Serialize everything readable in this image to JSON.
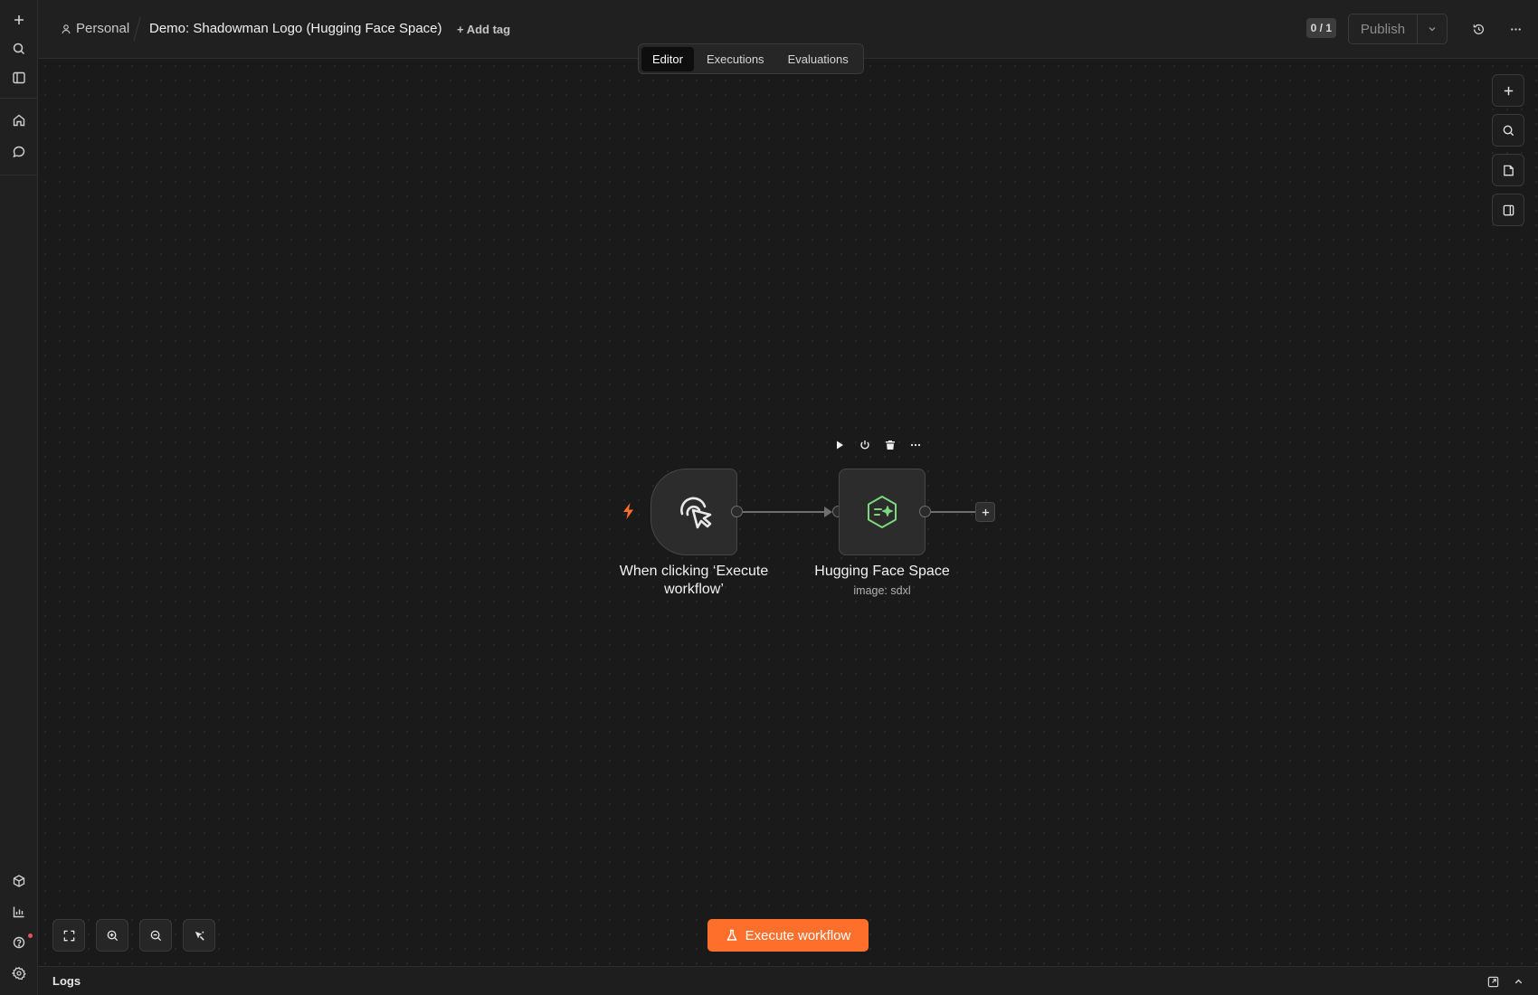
{
  "header": {
    "project_label": "Personal",
    "workflow_title": "Demo: Shadowman Logo (Hugging Face Space)",
    "add_tag_label": "+ Add tag",
    "counter": "0 / 1",
    "publish_label": "Publish"
  },
  "tabs": [
    {
      "label": "Editor",
      "active": true
    },
    {
      "label": "Executions",
      "active": false
    },
    {
      "label": "Evaluations",
      "active": false
    }
  ],
  "nodes": {
    "trigger": {
      "label": "When clicking ‘Execute workflow’",
      "icon": "pointer-click-icon"
    },
    "hugging_face": {
      "label": "Hugging Face Space",
      "subtitle": "image: sdxl",
      "icon": "hugging-face-hexagon-icon"
    }
  },
  "execute_button": {
    "label": "Execute workflow"
  },
  "logs": {
    "label": "Logs"
  },
  "colors": {
    "accent": "#ff6f2c",
    "background": "#1a1a1a",
    "panel": "#202020",
    "hf_icon": "#7dd87d"
  }
}
